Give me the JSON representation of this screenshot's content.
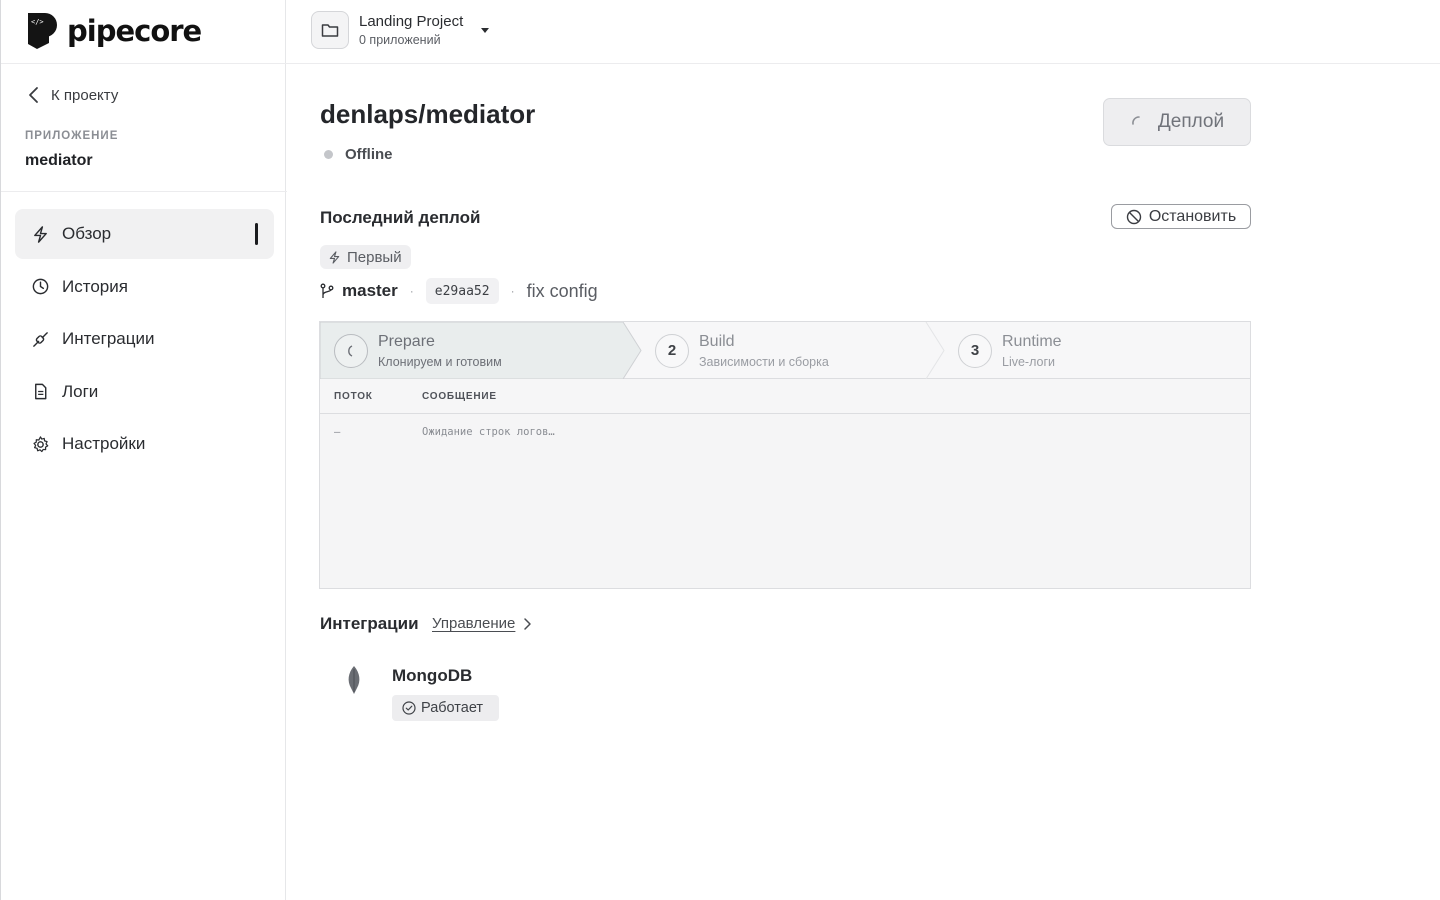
{
  "brand": {
    "name": "pipecore"
  },
  "project": {
    "name": "Landing Project",
    "apps_count": "0 приложений"
  },
  "sidebar": {
    "back_label": "К проекту",
    "app_kicker": "ПРИЛОЖЕНИЕ",
    "app_name": "mediator",
    "items": [
      {
        "label": "Обзор",
        "icon": "bolt-icon",
        "active": true
      },
      {
        "label": "История",
        "icon": "clock-icon",
        "active": false
      },
      {
        "label": "Интеграции",
        "icon": "plug-icon",
        "active": false
      },
      {
        "label": "Логи",
        "icon": "document-icon",
        "active": false
      },
      {
        "label": "Настройки",
        "icon": "gear-icon",
        "active": false
      }
    ]
  },
  "app": {
    "title": "denlaps/mediator",
    "status": "Offline"
  },
  "deploy_button": {
    "label": "Деплой",
    "state": "loading"
  },
  "last_deploy": {
    "title": "Последний деплой",
    "stop_label": "Остановить",
    "tag": "Первый",
    "branch": "master",
    "commit_hash": "e29aa52",
    "commit_message": "fix config"
  },
  "pipeline": {
    "steps": [
      {
        "number": "",
        "name": "Prepare",
        "desc": "Клонируем и готовим",
        "state": "running"
      },
      {
        "number": "2",
        "name": "Build",
        "desc": "Зависимости и сборка",
        "state": "pending"
      },
      {
        "number": "3",
        "name": "Runtime",
        "desc": "Live-логи",
        "state": "pending"
      }
    ]
  },
  "log": {
    "col_stream": "ПОТОК",
    "col_message": "СООБЩЕНИЕ",
    "rows": [
      {
        "stream": "—",
        "message": "Ожидание строк логов…"
      }
    ]
  },
  "integrations": {
    "title": "Интеграции",
    "manage_label": "Управление",
    "items": [
      {
        "name": "MongoDB",
        "status": "Работает",
        "icon": "mongodb-leaf-icon"
      }
    ]
  },
  "colors": {
    "accent_dark": "#1b1c1f",
    "offline_dot": "#c4c6ca",
    "muted": "#8b8e94"
  }
}
